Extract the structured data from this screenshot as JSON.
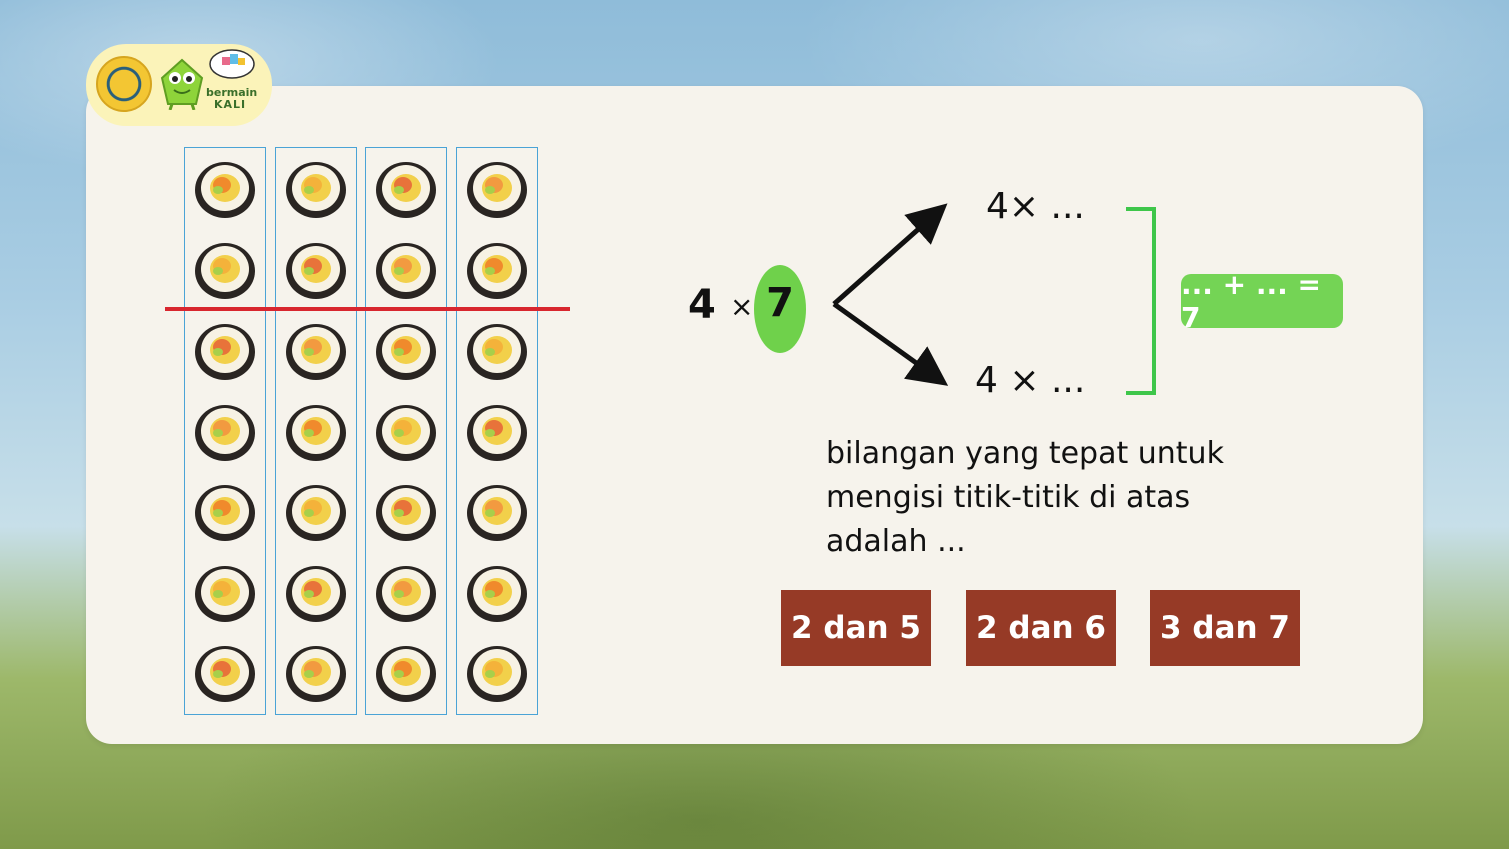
{
  "branding": {
    "line1": "bermain",
    "line2": "KALI"
  },
  "problem": {
    "left_factor": "4",
    "operator": "×",
    "right_factor": "7",
    "branch_top": "4× ...",
    "branch_bottom": "4 × ...",
    "sum_hint": "... + ... = 7"
  },
  "question_lines": [
    "bilangan yang tepat untuk",
    "mengisi titik-titik di atas",
    "adalah ..."
  ],
  "answers": [
    {
      "label": "2 dan 5"
    },
    {
      "label": "2 dan 6"
    },
    {
      "label": "3 dan 7"
    }
  ],
  "array_model": {
    "columns": 4,
    "rows": 7,
    "split_after_row": 2
  },
  "colors": {
    "card": "#f6f3ec",
    "highlight_green": "#6fd14b",
    "answer_button": "#963a26",
    "split_line": "#d8262e",
    "column_border": "#4aa3d6"
  }
}
